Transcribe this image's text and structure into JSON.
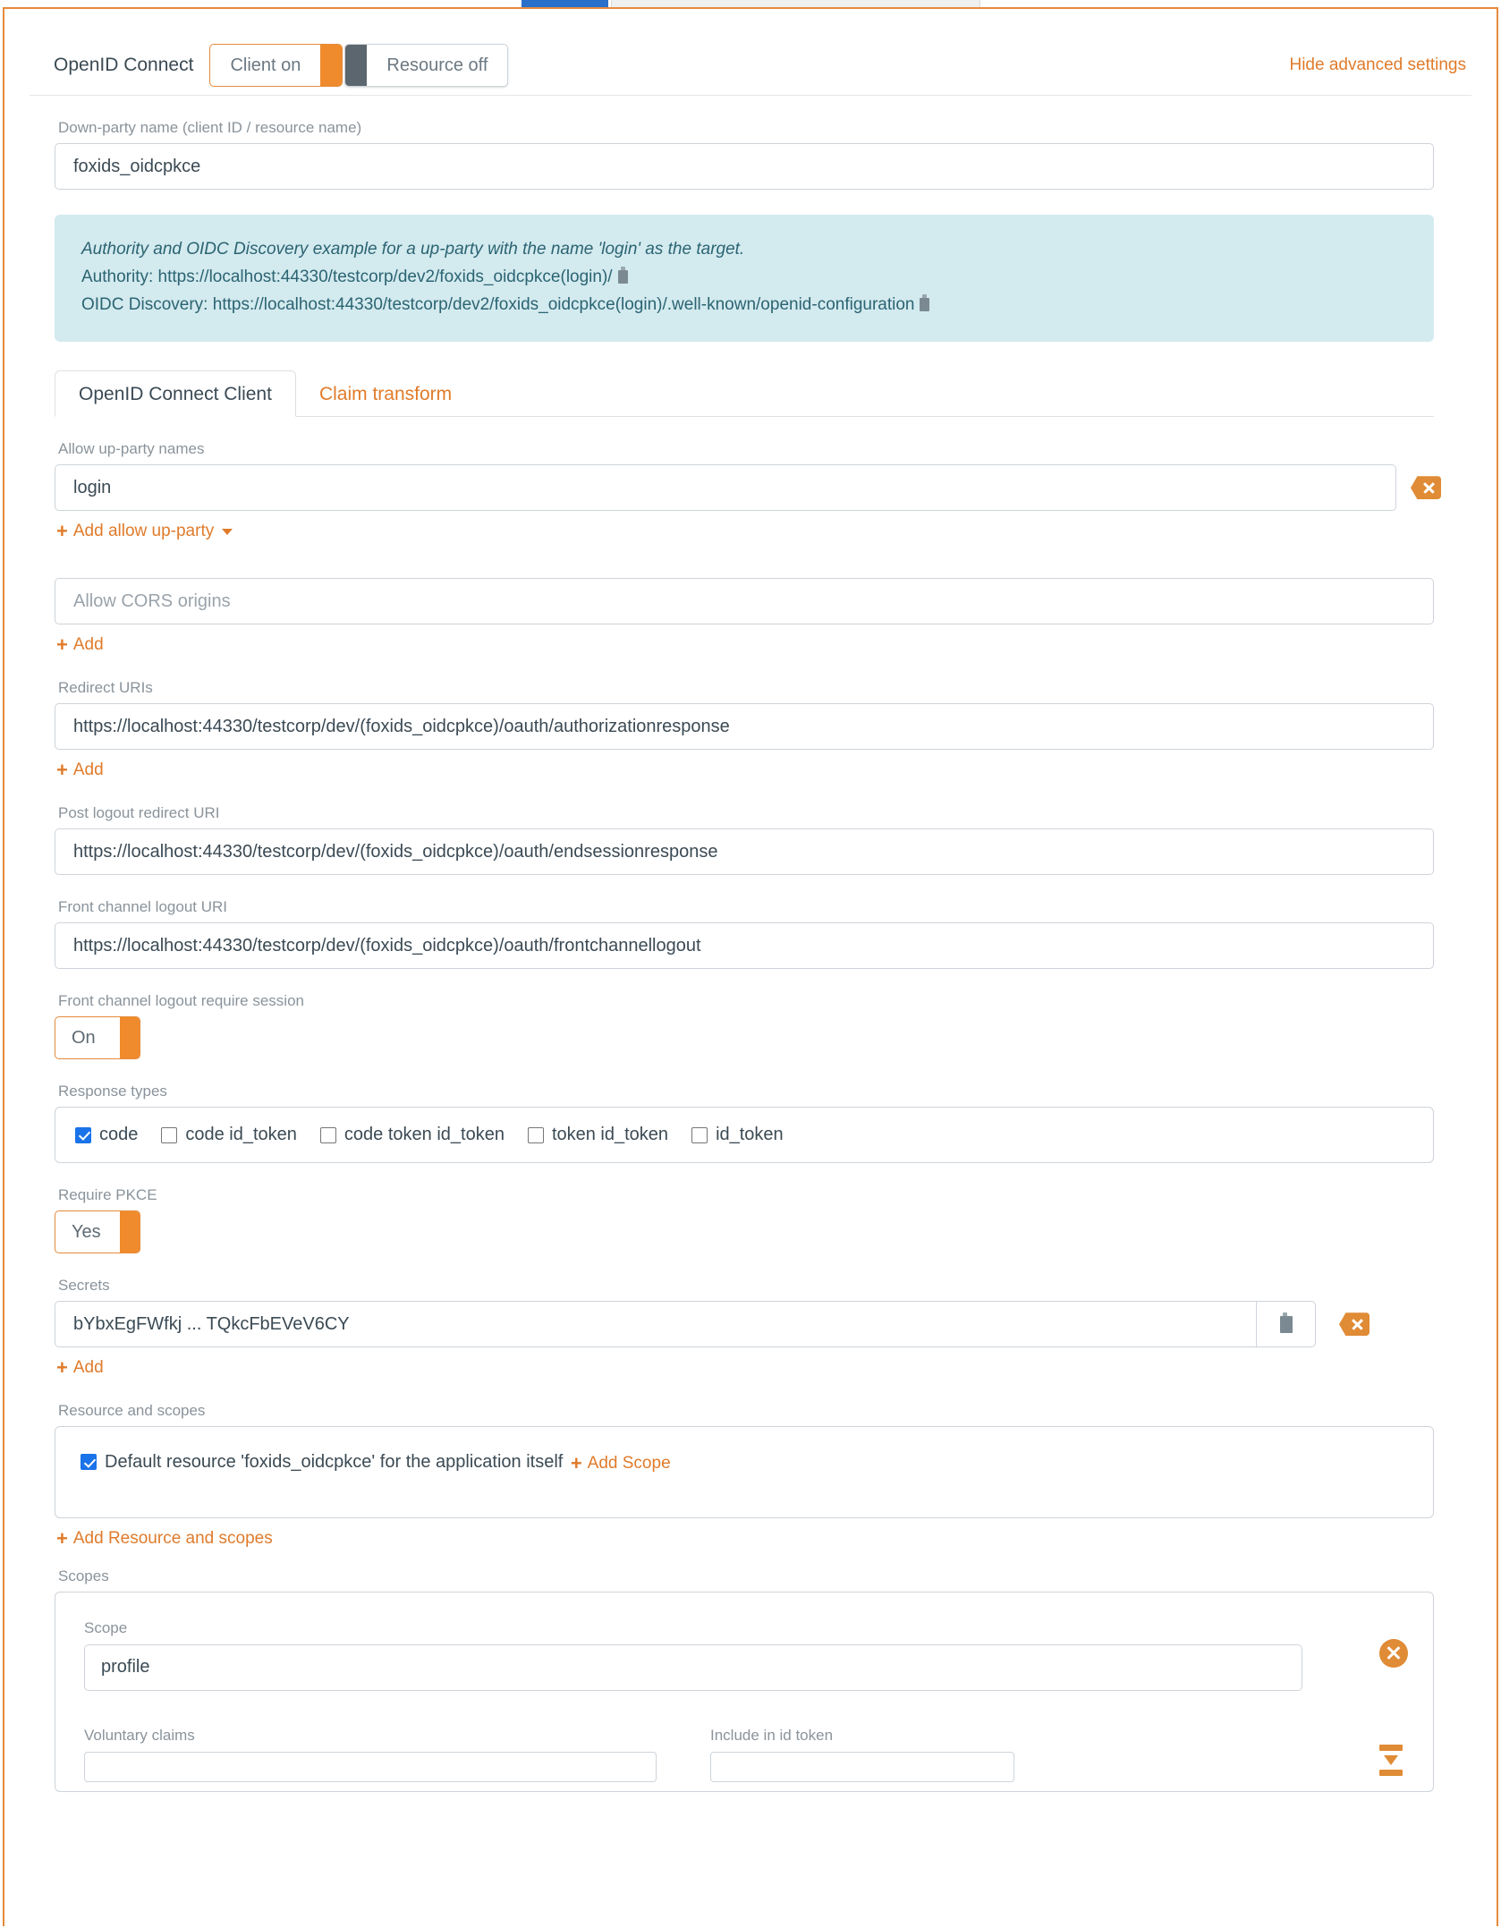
{
  "browser": {
    "active_tab": "",
    "inactive_tab": ""
  },
  "header": {
    "title": "OpenID Connect",
    "client_toggle": {
      "label": "Client on",
      "state": "on"
    },
    "resource_toggle": {
      "label": "Resource off",
      "state": "off"
    },
    "hide_advanced": "Hide advanced settings"
  },
  "down_party": {
    "label": "Down-party name (client ID / resource name)",
    "value": "foxids_oidcpkce"
  },
  "info_box": {
    "line1": "Authority and OIDC Discovery example for a up-party with the name 'login' as the target.",
    "line2_label": "Authority:",
    "line2_value": "https://localhost:44330/testcorp/dev2/foxids_oidcpkce(login)/",
    "line3_label": "OIDC Discovery:",
    "line3_value": "https://localhost:44330/testcorp/dev2/foxids_oidcpkce(login)/.well-known/openid-configuration",
    "copy_icon": "clipboard-icon"
  },
  "tabs": [
    {
      "label": "OpenID Connect Client",
      "active": true
    },
    {
      "label": "Claim transform",
      "active": false
    }
  ],
  "allow_up_party": {
    "label": "Allow up-party names",
    "value": "login",
    "clear_icon": "backspace-delete-icon",
    "add_link": "Add allow up-party"
  },
  "cors": {
    "placeholder": "Allow CORS origins",
    "add_link": "Add"
  },
  "redirect_uris": {
    "label": "Redirect URIs",
    "value": "https://localhost:44330/testcorp/dev/(foxids_oidcpkce)/oauth/authorizationresponse",
    "add_link": "Add"
  },
  "post_logout": {
    "label": "Post logout redirect URI",
    "value": "https://localhost:44330/testcorp/dev/(foxids_oidcpkce)/oauth/endsessionresponse"
  },
  "front_channel_logout": {
    "label": "Front channel logout URI",
    "value": "https://localhost:44330/testcorp/dev/(foxids_oidcpkce)/oauth/frontchannellogout"
  },
  "front_channel_require_session": {
    "label": "Front channel logout require session",
    "value": "On"
  },
  "response_types": {
    "label": "Response types",
    "options": [
      {
        "label": "code",
        "checked": true
      },
      {
        "label": "code id_token",
        "checked": false
      },
      {
        "label": "code token id_token",
        "checked": false
      },
      {
        "label": "token id_token",
        "checked": false
      },
      {
        "label": "id_token",
        "checked": false
      }
    ]
  },
  "require_pkce": {
    "label": "Require PKCE",
    "value": "Yes"
  },
  "secrets": {
    "label": "Secrets",
    "value": "bYbxEgFWfkj  ...  TQkcFbEVeV6CY",
    "copy_icon": "clipboard-icon",
    "delete_icon": "backspace-delete-icon",
    "add_link": "Add"
  },
  "resource_and_scopes": {
    "label": "Resource and scopes",
    "default_resource": {
      "label": "Default resource 'foxids_oidcpkce' for the application itself",
      "checked": true
    },
    "add_scope_link": "Add Scope",
    "add_resource_link": "Add Resource and scopes"
  },
  "scopes": {
    "label": "Scopes",
    "scope_field_label": "Scope",
    "scope_value": "profile",
    "remove_icon": "circle-x-icon",
    "collapse_icon": "collapse-icon",
    "voluntary_claims_label": "Voluntary claims",
    "voluntary_claims_value": "",
    "include_in_id_token_label": "Include in id token",
    "include_in_id_token_value": ""
  },
  "colors": {
    "accent": "#e07b2b",
    "toggle_on": "#ef8b2c",
    "toggle_off": "#5c666e",
    "info_bg": "#d3eaef",
    "info_text": "#2b6472",
    "checkbox_checked": "#1a73e8",
    "label_text": "#8a939b",
    "value_text": "#3b4a54"
  }
}
